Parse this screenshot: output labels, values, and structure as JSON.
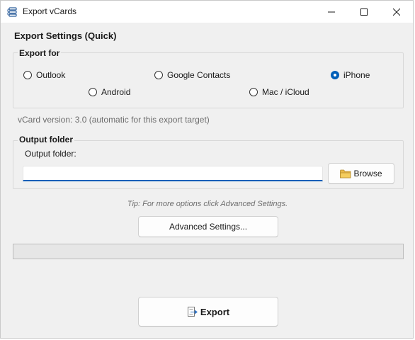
{
  "window": {
    "title": "Export vCards",
    "icon": "vcard-app-icon"
  },
  "heading": "Export Settings (Quick)",
  "export_for": {
    "label": "Export for",
    "options": [
      {
        "label": "Outlook",
        "checked": false
      },
      {
        "label": "Google Contacts",
        "checked": false
      },
      {
        "label": "iPhone",
        "checked": true
      },
      {
        "label": "Android",
        "checked": false
      },
      {
        "label": "Mac / iCloud",
        "checked": false
      }
    ]
  },
  "vcard_version": "vCard version: 3.0 (automatic for this export target)",
  "output": {
    "group_label": "Output folder",
    "field_label": "Output folder:",
    "value": "",
    "placeholder": "",
    "browse_label": "Browse"
  },
  "tip": "Tip: For more options click Advanced Settings.",
  "advanced_label": "Advanced Settings...",
  "progress": {
    "value": 0
  },
  "export_label": "Export",
  "colors": {
    "accent": "#005fb8",
    "background": "#f0f0f0",
    "progress_fill": "#06b025"
  }
}
